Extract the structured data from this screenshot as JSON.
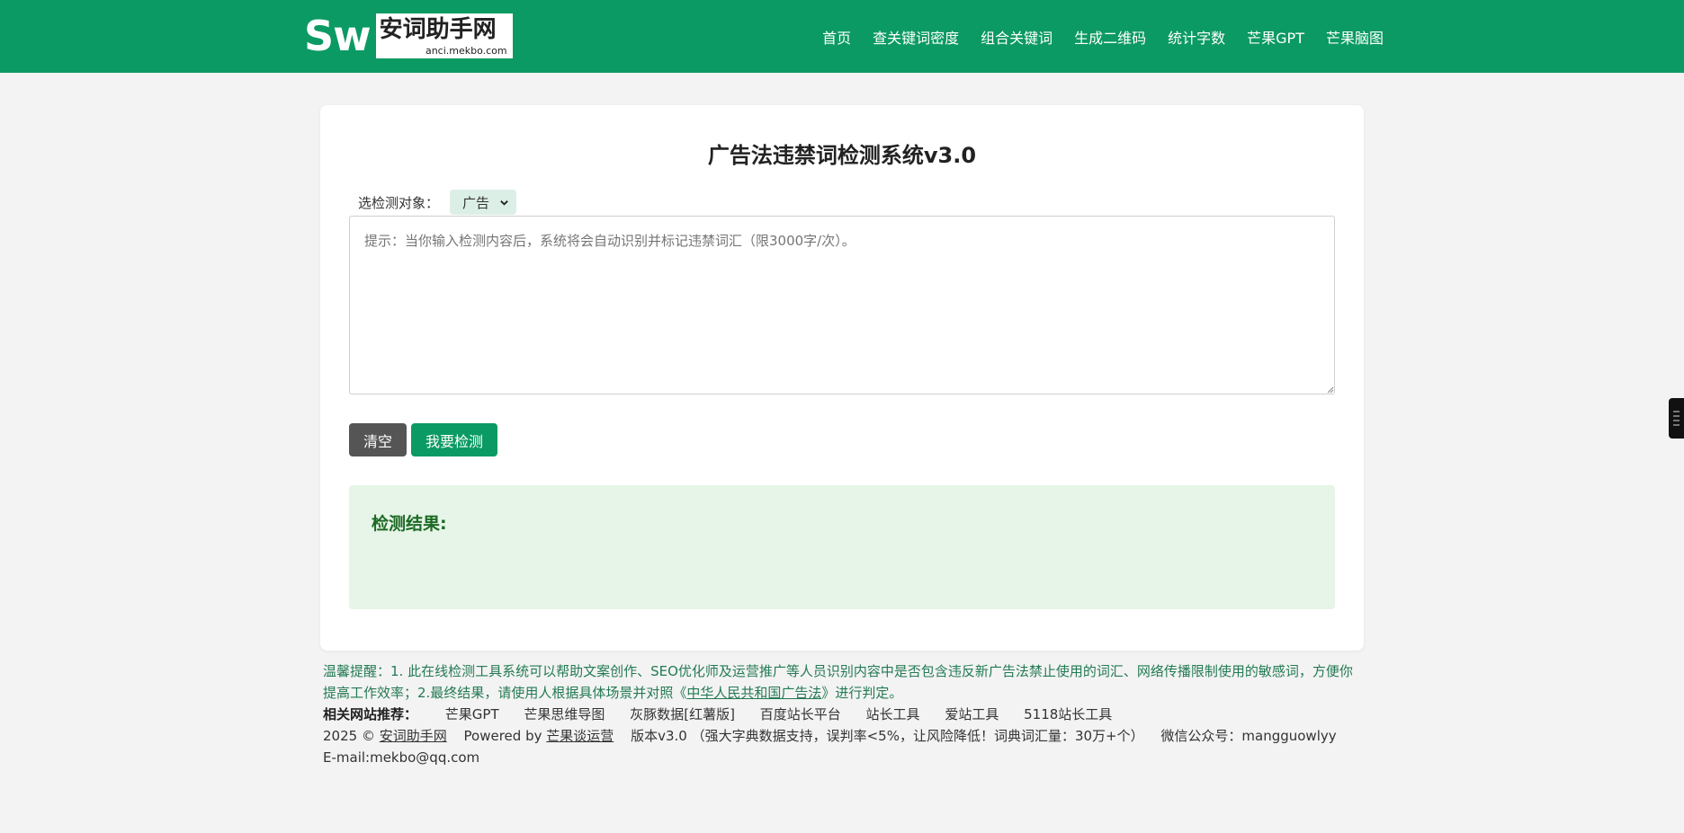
{
  "header": {
    "logo_sw": "Sw",
    "logo_name": "安词助手网",
    "logo_url": "anci.mekbo.com",
    "nav": [
      "首页",
      "查关键词密度",
      "组合关键词",
      "生成二维码",
      "统计字数",
      "芒果GPT",
      "芒果脑图"
    ]
  },
  "main": {
    "title": "广告法违禁词检测系统v3.0",
    "select_label": "选检测对象：",
    "select_value": "广告",
    "textarea_placeholder": "提示：当你输入检测内容后，系统将会自动识别并标记违禁词汇（限3000字/次）。",
    "clear_button": "清空",
    "check_button": "我要检测",
    "result_title": "检测结果:"
  },
  "footer": {
    "tip_prefix": "温馨提醒：1. 此在线检测工具系统可以帮助文案创作、SEO优化师及运营推广等人员识别内容中是否包含违反新广告法禁止使用的词汇、网络传播限制使用的敏感词，方便你提高工作效率；2.最终结果，请使用人根据具体场景并对照《",
    "tip_link": "中华人民共和国广告法",
    "tip_suffix": "》进行判定。",
    "related_label": "相关网站推荐：",
    "related_links": [
      "芒果GPT",
      "芒果思维导图",
      "灰豚数据[红薯版]",
      "百度站长平台",
      "站长工具",
      "爱站工具",
      "5118站长工具"
    ],
    "copy_year": "2025 ©",
    "copy_site": "安词助手网",
    "powered_by": "Powered by",
    "powered_link": "芒果谈运营",
    "version": "版本v3.0",
    "version_note": "（强大字典数据支持，误判率<5%，让风险降低！词典词汇量：30万+个）",
    "wechat": "微信公众号：mangguowlyy",
    "email": "E-mail:mekbo@qq.com"
  },
  "colors": {
    "brand": "#0b9a63",
    "result_bg": "#e6f5e8",
    "result_title": "#1d6a24",
    "clear_btn": "#555555"
  }
}
